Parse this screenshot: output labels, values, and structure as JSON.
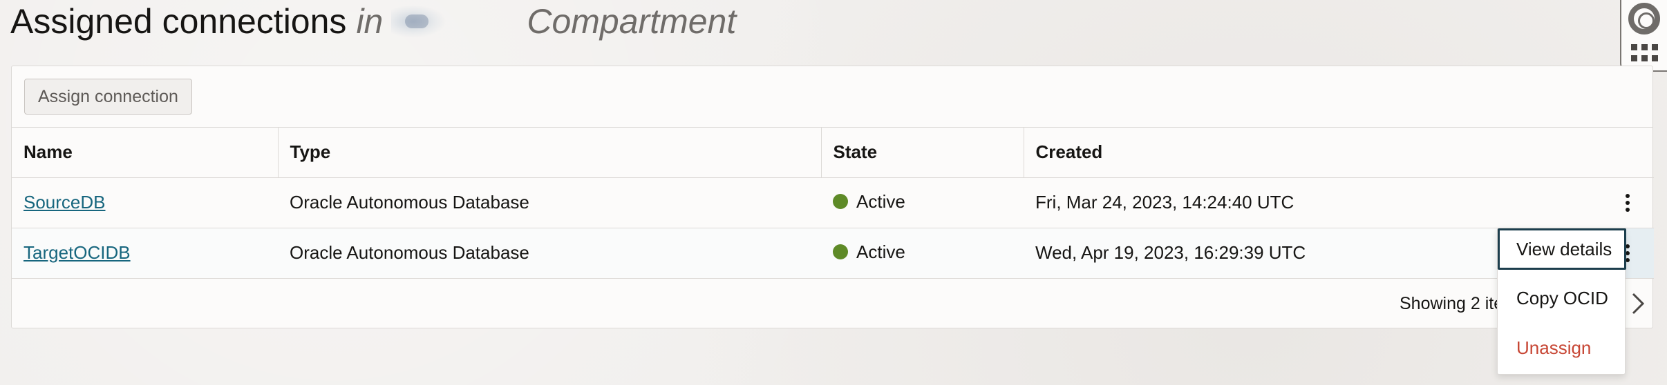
{
  "header": {
    "title": "Assigned connections",
    "in_label": "in",
    "compartment_label": "Compartment"
  },
  "toolbar": {
    "assign_label": "Assign connection"
  },
  "table": {
    "columns": [
      "Name",
      "Type",
      "State",
      "Created"
    ],
    "rows": [
      {
        "name": "SourceDB",
        "type": "Oracle Autonomous Database",
        "state": "Active",
        "created": "Fri, Mar 24, 2023, 14:24:40 UTC"
      },
      {
        "name": "TargetOCIDB",
        "type": "Oracle Autonomous Database",
        "state": "Active",
        "created": "Wed, Apr 19, 2023, 16:29:39 UTC"
      }
    ]
  },
  "footer": {
    "showing_text": "Showing 2 items"
  },
  "menu": {
    "items": [
      "View details",
      "Copy OCID",
      "Unassign"
    ]
  },
  "colors": {
    "active_dot": "#5e8a27",
    "link": "#17667e",
    "danger": "#c74634"
  }
}
